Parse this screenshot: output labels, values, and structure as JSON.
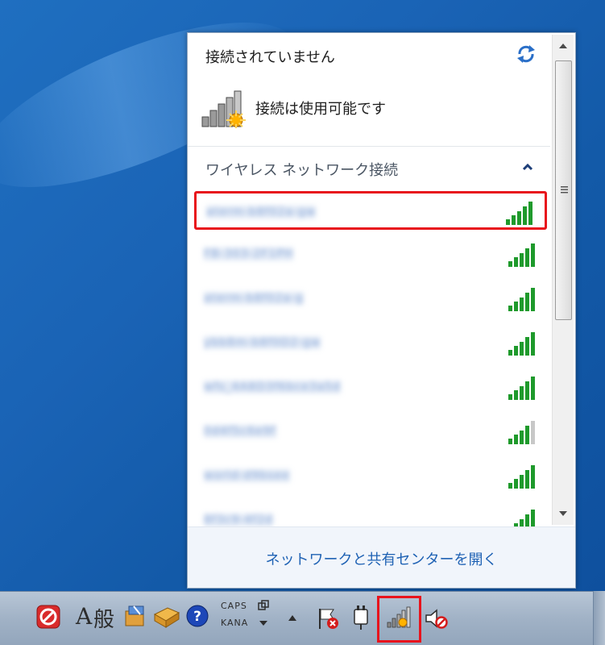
{
  "flyout": {
    "status_title": "接続されていません",
    "connection_status": "接続は使用可能です",
    "section_header": "ワイヤレス ネットワーク接続",
    "footer_link": "ネットワークと共有センターを開く"
  },
  "networks": [
    {
      "name": "aterm-b8f02a-gw",
      "signal_bars": 5,
      "highlighted": true
    },
    {
      "name": "FB-303-2F1PH",
      "signal_bars": 5,
      "highlighted": false
    },
    {
      "name": "aterm-b8f02a-g",
      "signal_bars": 5,
      "highlighted": false
    },
    {
      "name": "ybb8m-b8f0D2-gw",
      "signal_bars": 5,
      "highlighted": false
    },
    {
      "name": "wfs_4A8D3f6bce3a5d",
      "signal_bars": 5,
      "highlighted": false
    },
    {
      "name": "0d4f5c6e9f",
      "signal_bars": 4,
      "highlighted": false
    },
    {
      "name": "world-d9bsee",
      "signal_bars": 5,
      "highlighted": false
    },
    {
      "name": "8f3c9-4f2d",
      "signal_bars": 5,
      "highlighted": false
    }
  ],
  "taskbar": {
    "ime_mode": "A",
    "ime_input": "般",
    "caps": "CAPS",
    "kana": "KANA"
  },
  "colors": {
    "highlight": "#e8131c",
    "link": "#1f62b4",
    "signal_green": "#1f9a2c"
  }
}
